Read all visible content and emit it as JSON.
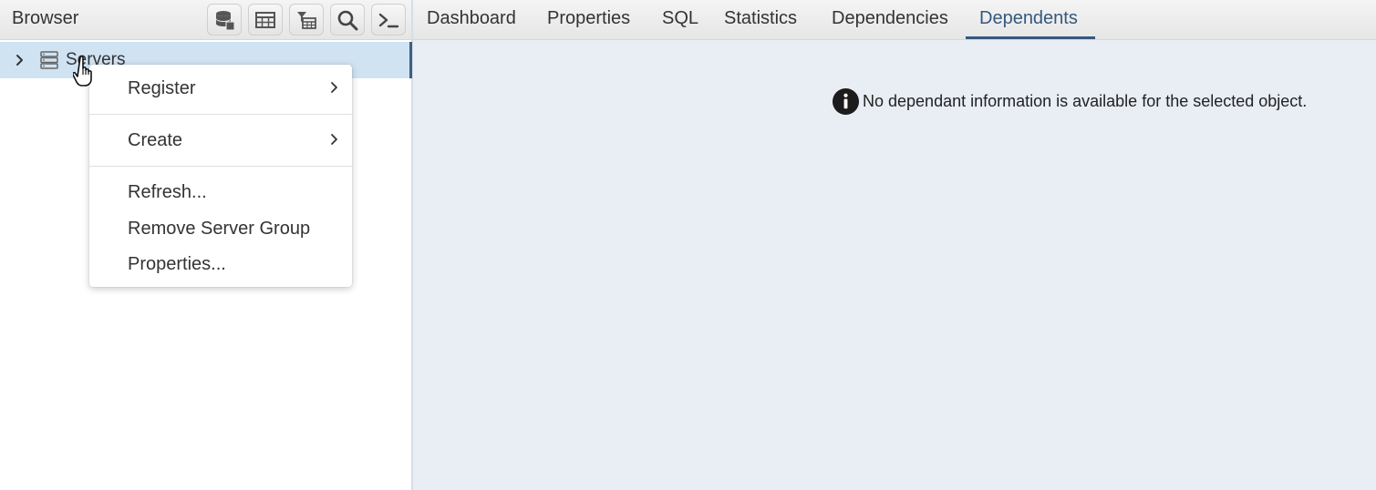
{
  "browser": {
    "title": "Browser",
    "toolbar": [
      {
        "icon": "database-icon"
      },
      {
        "icon": "table-icon"
      },
      {
        "icon": "filtered-table-icon"
      },
      {
        "icon": "search-icon"
      },
      {
        "icon": "terminal-icon"
      }
    ],
    "tree": {
      "root_label": "Servers"
    }
  },
  "context_menu": {
    "items": [
      {
        "label": "Register",
        "has_submenu": true
      },
      {
        "label": "Create",
        "has_submenu": true
      },
      {
        "label": "Refresh..."
      },
      {
        "label": "Remove Server Group"
      },
      {
        "label": "Properties..."
      }
    ]
  },
  "tabs": [
    {
      "label": "Dashboard"
    },
    {
      "label": "Properties"
    },
    {
      "label": "SQL"
    },
    {
      "label": "Statistics"
    },
    {
      "label": "Dependencies"
    },
    {
      "label": "Dependents",
      "active": true
    }
  ],
  "content": {
    "message": "No dependant information is available for the selected object."
  },
  "colors": {
    "accent": "#36587d",
    "selection": "#cfe3f3",
    "content_bg": "#e9edf4"
  }
}
